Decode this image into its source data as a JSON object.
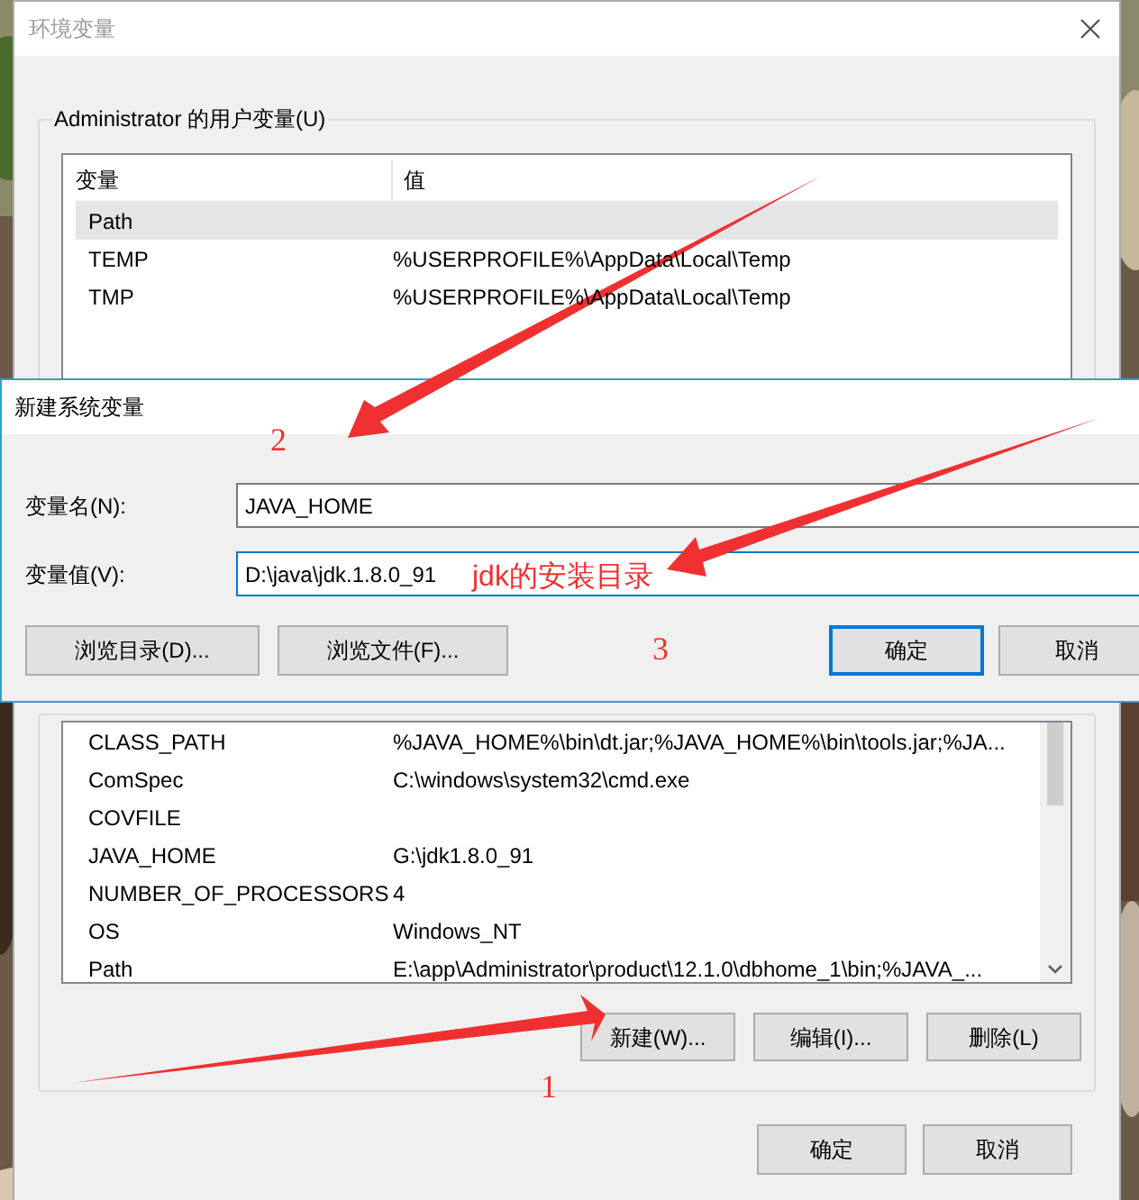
{
  "window": {
    "title": "环境变量"
  },
  "user_variables": {
    "label": "Administrator 的用户变量(U)",
    "columns": [
      "变量",
      "值"
    ],
    "rows": [
      {
        "name": "Path",
        "value": "",
        "selected": true
      },
      {
        "name": "TEMP",
        "value": "%USERPROFILE%\\AppData\\Local\\Temp",
        "selected": false
      },
      {
        "name": "TMP",
        "value": "%USERPROFILE%\\AppData\\Local\\Temp",
        "selected": false
      }
    ]
  },
  "system_variables": {
    "rows": [
      {
        "name": "CLASS_PATH",
        "value": "%JAVA_HOME%\\bin\\dt.jar;%JAVA_HOME%\\bin\\tools.jar;%JA...",
        "selected": false
      },
      {
        "name": "ComSpec",
        "value": "C:\\windows\\system32\\cmd.exe",
        "selected": false
      },
      {
        "name": "COVFILE",
        "value": "",
        "selected": false
      },
      {
        "name": "JAVA_HOME",
        "value": "G:\\jdk1.8.0_91",
        "selected": false
      },
      {
        "name": "NUMBER_OF_PROCESSORS",
        "value": "4",
        "selected": false
      },
      {
        "name": "OS",
        "value": "Windows_NT",
        "selected": false
      },
      {
        "name": "Path",
        "value": "E:\\app\\Administrator\\product\\12.1.0\\dbhome_1\\bin;%JAVA_...",
        "selected": false
      }
    ],
    "buttons": [
      "新建(W)...",
      "编辑(I)...",
      "删除(L)"
    ]
  },
  "footer_buttons": [
    "确定",
    "取消"
  ],
  "dialog": {
    "title": "新建系统变量",
    "fields": [
      {
        "label": "变量名(N):",
        "value": "JAVA_HOME",
        "focused": false
      },
      {
        "label": "变量值(V):",
        "value": "D:\\java\\jdk.1.8.0_91",
        "focused": true
      }
    ],
    "buttons": [
      {
        "label": "浏览目录(D)...",
        "default": false
      },
      {
        "label": "浏览文件(F)...",
        "default": false
      },
      {
        "label": "确定",
        "default": true
      },
      {
        "label": "取消",
        "default": false
      }
    ]
  },
  "annotations": [
    {
      "kind": "number",
      "text": "1"
    },
    {
      "kind": "number",
      "text": "2"
    },
    {
      "kind": "note",
      "text": "jdk的安装目录"
    },
    {
      "kind": "number",
      "text": "3"
    }
  ]
}
